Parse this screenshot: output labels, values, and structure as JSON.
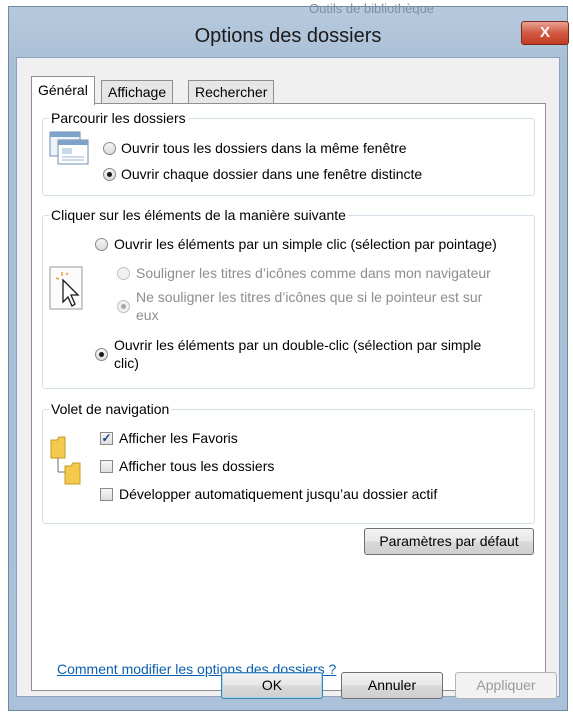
{
  "window": {
    "title": "Options des dossiers",
    "background_title": "Outils de bibliothèque",
    "close_glyph": "X"
  },
  "tabs": [
    {
      "label": "Général",
      "active": true
    },
    {
      "label": "Affichage",
      "active": false
    },
    {
      "label": "Rechercher",
      "active": false
    }
  ],
  "browse": {
    "legend": "Parcourir les dossiers",
    "icon": "folder-window-icon",
    "options": [
      {
        "label": "Ouvrir tous les dossiers dans la même fenêtre",
        "checked": false
      },
      {
        "label": "Ouvrir chaque dossier dans une fenêtre distincte",
        "checked": true
      }
    ]
  },
  "click": {
    "legend": "Cliquer sur les éléments de la manière suivante",
    "icon": "pointer-click-icon",
    "single_click": {
      "label": "Ouvrir les éléments par un simple clic (sélection par pointage)",
      "checked": false
    },
    "underline_browser": {
      "label": "Souligner les titres d’icônes comme dans mon navigateur",
      "checked": false,
      "disabled": true
    },
    "underline_point": {
      "line1": "Ne souligner les titres d’icônes que si le pointeur est sur",
      "line2": "eux",
      "checked": true,
      "disabled": true
    },
    "double_click": {
      "line1": "Ouvrir les éléments par un double-clic (sélection par simple",
      "line2": "clic)",
      "checked": true
    }
  },
  "navigation": {
    "legend": "Volet de navigation",
    "icon": "folder-tree-icon",
    "options": [
      {
        "label": "Afficher les Favoris",
        "checked": true
      },
      {
        "label": "Afficher tous les dossiers",
        "checked": false
      },
      {
        "label": "Développer automatiquement jusqu’au dossier actif",
        "checked": false
      }
    ]
  },
  "defaults_button": "Paramètres par défaut",
  "help_link": "Comment modifier les options des dossiers ?",
  "footer": {
    "ok": "OK",
    "cancel": "Annuler",
    "apply": "Appliquer"
  },
  "colors": {
    "accent_link": "#0b5fb0",
    "close_button": "#c33b23",
    "frame": "#a9bfd6"
  }
}
